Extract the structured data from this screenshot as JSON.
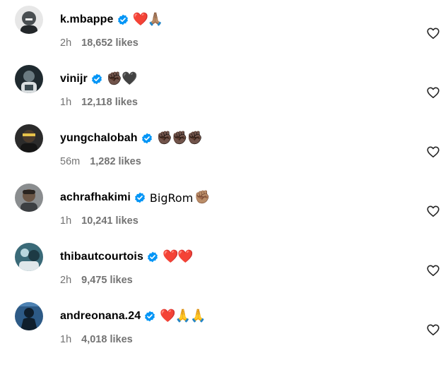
{
  "comments": [
    {
      "username": "k.mbappe",
      "text": "",
      "emoji": "❤️🙏🏽",
      "time": "2h",
      "likes": "18,652 likes",
      "avatar_color": "#4a4f52"
    },
    {
      "username": "vinijr",
      "text": "",
      "emoji": "✊🏿🖤",
      "time": "1h",
      "likes": "12,118 likes",
      "avatar_color": "#1f2a2f"
    },
    {
      "username": "yungchalobah",
      "text": "",
      "emoji": "✊🏿✊🏿✊🏿",
      "time": "56m",
      "likes": "1,282 likes",
      "avatar_color": "#2b2b2b"
    },
    {
      "username": "achrafhakimi",
      "text": "BigRom",
      "emoji": "✊🏽",
      "time": "1h",
      "likes": "10,241 likes",
      "avatar_color": "#5b5e60"
    },
    {
      "username": "thibautcourtois",
      "text": "",
      "emoji": "❤️❤️",
      "time": "2h",
      "likes": "9,475 likes",
      "avatar_color": "#3a6a78"
    },
    {
      "username": "andreonana.24",
      "text": "",
      "emoji": "❤️🙏🙏",
      "time": "1h",
      "likes": "4,018 likes",
      "avatar_color": "#2d5a86"
    }
  ],
  "icons": {
    "verified": "verified-badge-icon",
    "like": "heart-outline-icon"
  },
  "colors": {
    "verified": "#0095f6",
    "meta_text": "#737373"
  }
}
